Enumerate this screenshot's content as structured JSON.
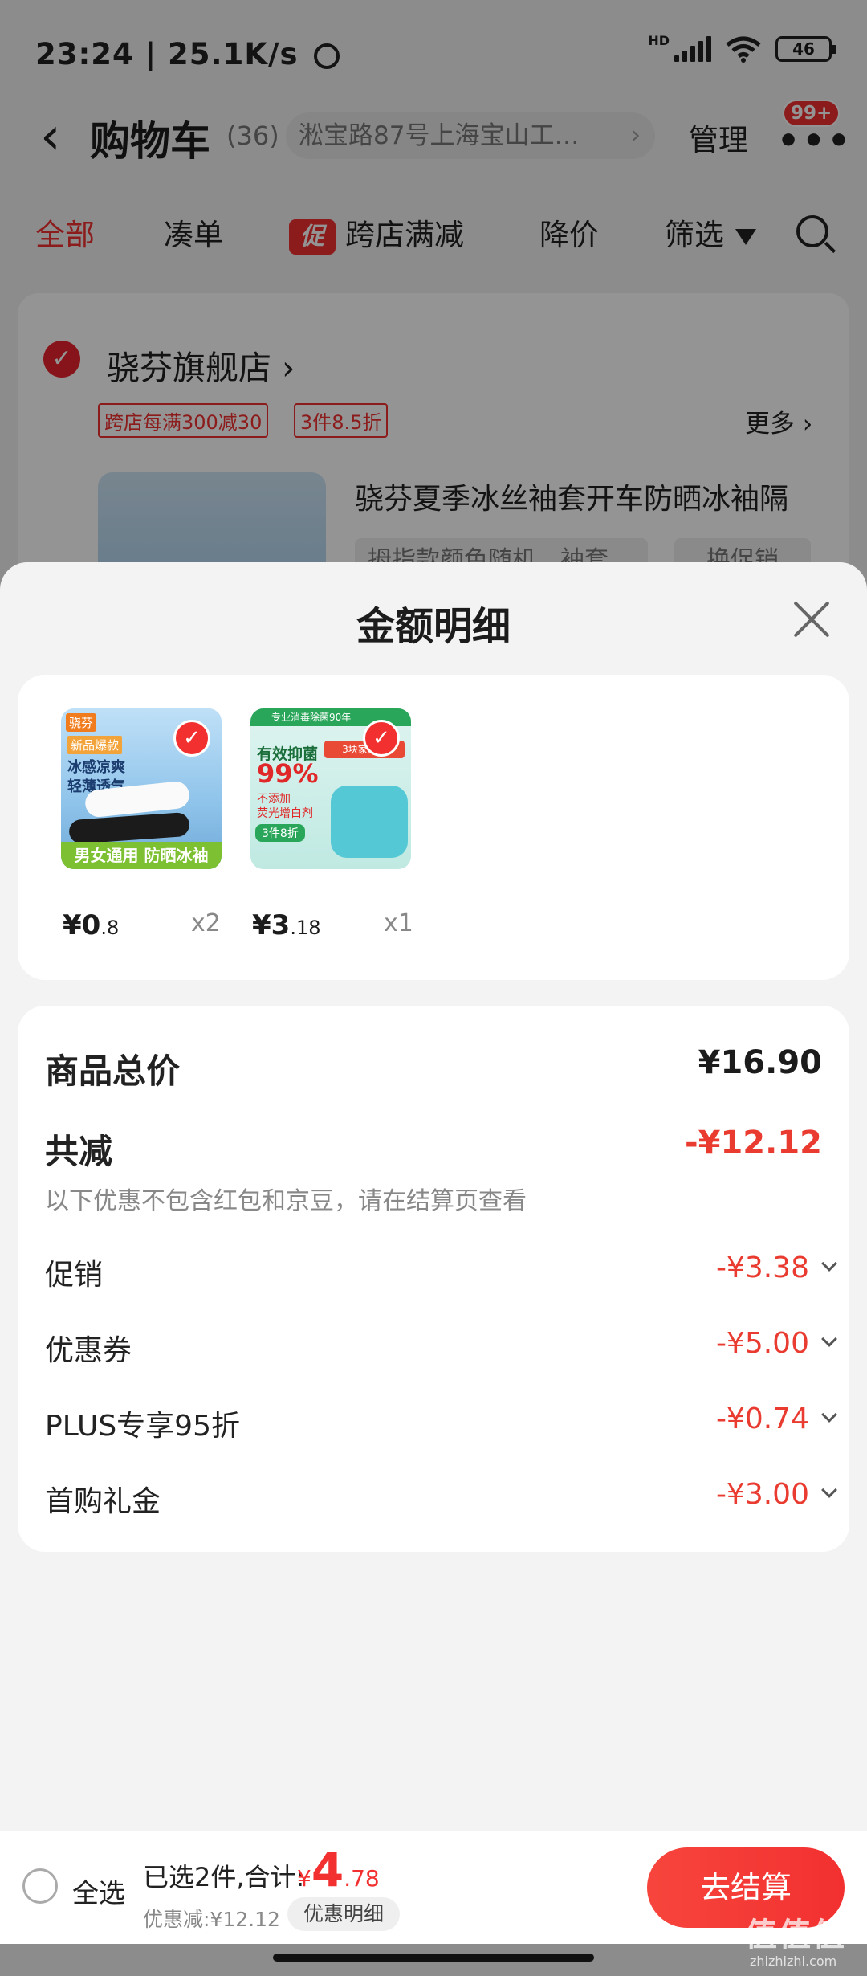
{
  "status_bar": {
    "time_speed": "23:24 | 25.1K/s",
    "alarm_icon": "alarm-icon",
    "network_label": "HD",
    "battery": "46"
  },
  "header": {
    "title": "购物车",
    "count": "(36)",
    "address": "淞宝路87号上海宝山工…",
    "manage": "管理",
    "badge": "99+"
  },
  "tabs": [
    {
      "label": "全部",
      "active": true
    },
    {
      "label": "凑单"
    },
    {
      "label": "跨店满减",
      "tag": "促"
    },
    {
      "label": "降价"
    },
    {
      "label": "筛选"
    }
  ],
  "store": {
    "name": "骁芬旗舰店",
    "tags": [
      "跨店每满300减30",
      "3件8.5折"
    ],
    "more": "更多",
    "product_title": "骁芬夏季冰丝袖套开车防晒冰袖隔",
    "spec": "拇指款颜色随机，袖套",
    "change": "换促销"
  },
  "sheet": {
    "title": "金额明细",
    "items": [
      {
        "price_int": "¥0",
        "price_dec": ".8",
        "qty": "x2",
        "img_tag": "骁芬",
        "img_badge": "新品爆款",
        "img_text": "冰感凉爽\n轻薄透气",
        "img_strip": "男女通用 防晒冰袖"
      },
      {
        "price_int": "¥3",
        "price_dec": ".18",
        "qty": "x1",
        "img_band": "专业消毒除菌90年",
        "img_head": "有效抑菌",
        "img_pct": "99%",
        "img_sub": "不添加\n荧光增白剂",
        "img_chip": "3件8折",
        "img_pack": "3块家庭装"
      }
    ],
    "summary": {
      "total_label": "商品总价",
      "total_value": "¥16.90",
      "reduce_label": "共减",
      "reduce_value": "-¥12.12",
      "reduce_note": "以下优惠不包含红包和京豆，请在结算页查看",
      "discounts": [
        {
          "label": "促销",
          "value": "-¥3.38"
        },
        {
          "label": "优惠券",
          "value": "-¥5.00"
        },
        {
          "label": "PLUS专享95折",
          "value": "-¥0.74"
        },
        {
          "label": "首购礼金",
          "value": "-¥3.00"
        }
      ]
    }
  },
  "checkout": {
    "select_all": "全选",
    "selected_text": "已选2件,合计:",
    "total_cur": "¥",
    "total_int": "4",
    "total_dec": ".78",
    "saved_text": "优惠减:¥12.12",
    "detail_btn": "优惠明细",
    "checkout_btn": "去结算"
  },
  "watermark": {
    "text": "值值值",
    "url": "zhizhizhi.com"
  },
  "colors": {
    "accent": "#f23030",
    "discount": "#e93b30",
    "sheet_bg": "#f3f3f3"
  }
}
